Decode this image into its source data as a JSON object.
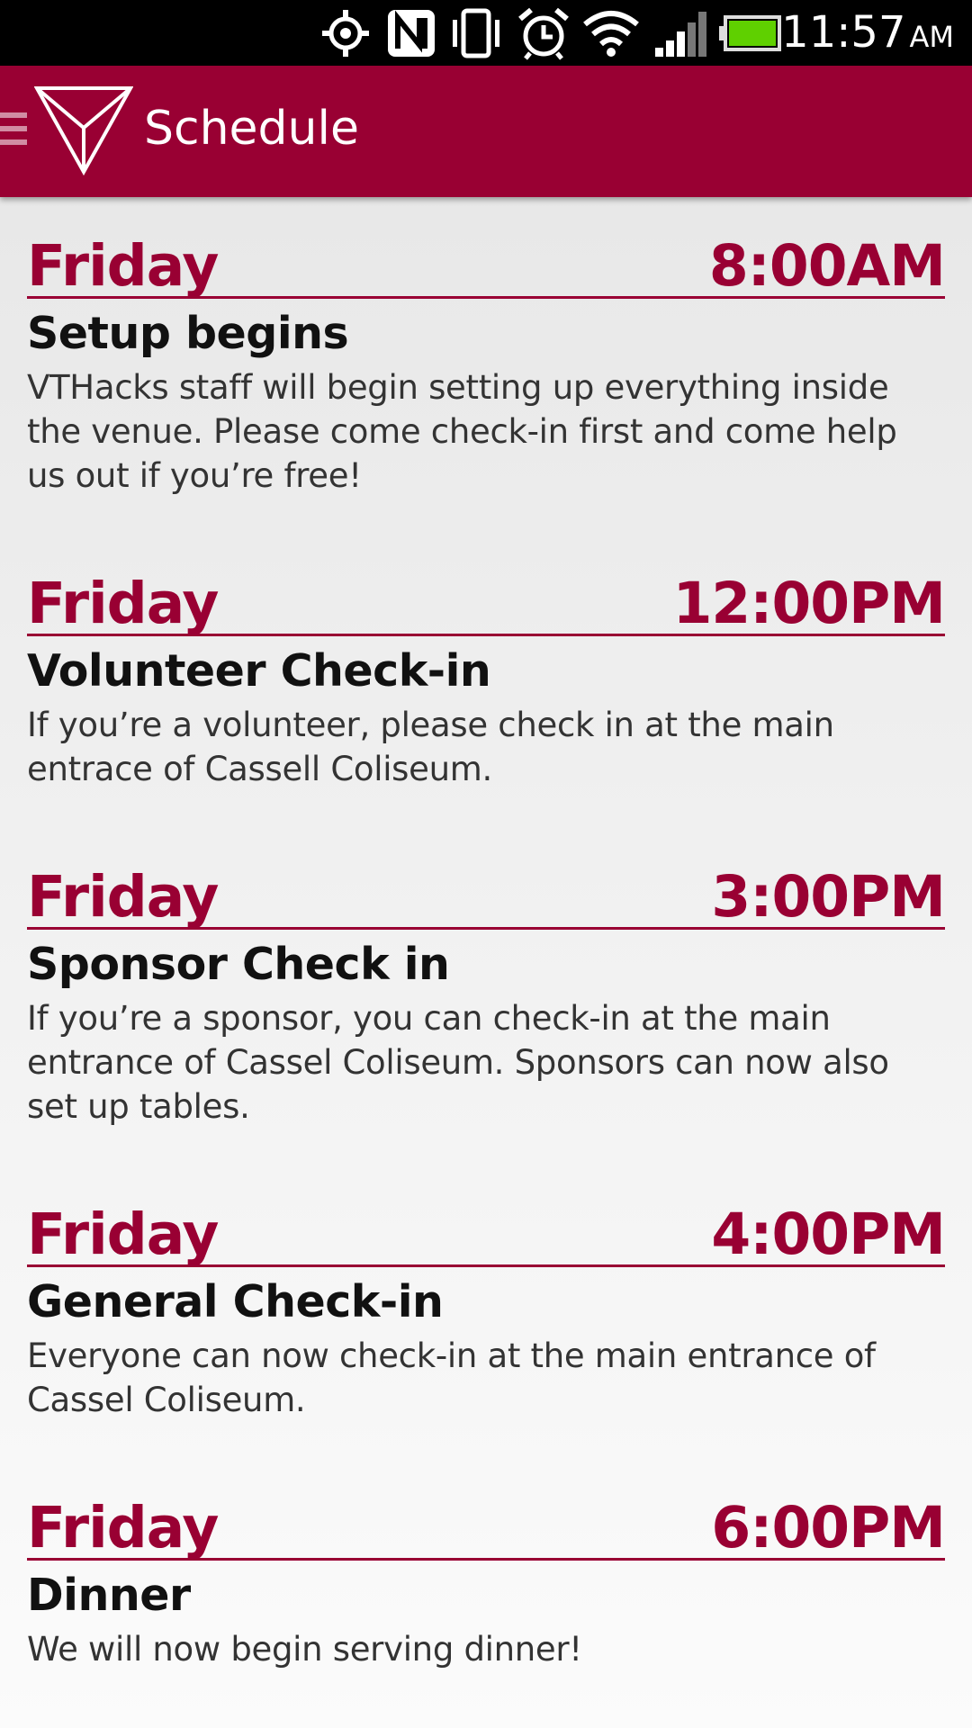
{
  "status_bar": {
    "time": "11:57",
    "ampm": "AM",
    "icons": [
      "gps-icon",
      "nfc-icon",
      "vibrate-icon",
      "alarm-icon",
      "wifi-icon",
      "signal-icon",
      "battery-icon"
    ],
    "battery_color": "#5fd000"
  },
  "app_bar": {
    "title": "Schedule",
    "color": "#990033"
  },
  "events": [
    {
      "day": "Friday",
      "time": "8:00AM",
      "title": "Setup begins",
      "description": "VTHacks staff will begin setting up everything inside the venue. Please come check-in first and come help us out if you’re free!"
    },
    {
      "day": "Friday",
      "time": "12:00PM",
      "title": "Volunteer Check-in",
      "description": "If you’re a volunteer, please check in at the main entrace of Cassell Coliseum."
    },
    {
      "day": "Friday",
      "time": "3:00PM",
      "title": "Sponsor Check in",
      "description": "If you’re a sponsor, you can check-in at the main entrance of Cassel Coliseum. Sponsors can now also set up tables."
    },
    {
      "day": "Friday",
      "time": "4:00PM",
      "title": "General Check-in",
      "description": "Everyone can now check-in at the main entrance of Cassel Coliseum."
    },
    {
      "day": "Friday",
      "time": "6:00PM",
      "title": "Dinner",
      "description": "We will now begin serving dinner!"
    }
  ]
}
